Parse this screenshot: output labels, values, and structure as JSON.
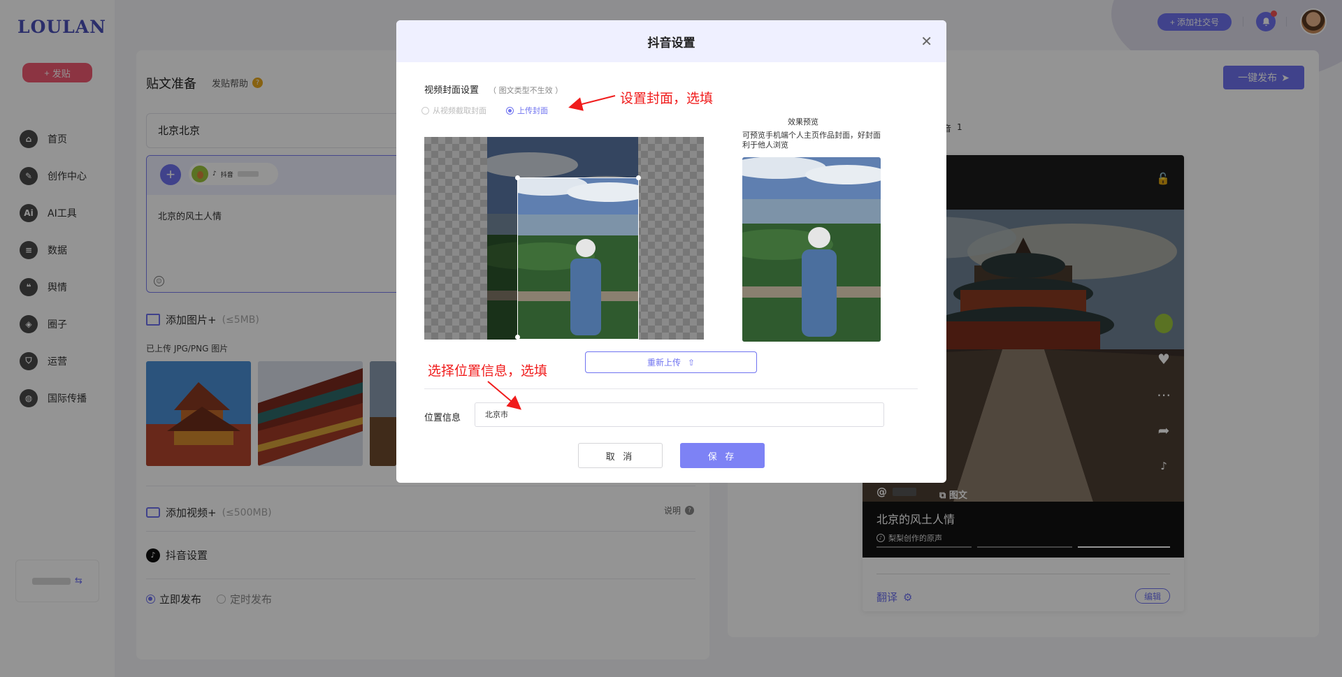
{
  "app": {
    "logo": "LOULAN",
    "post_button": "发贴"
  },
  "nav": {
    "items": [
      {
        "label": "首页",
        "icon": "home-icon",
        "glyph": "⌂"
      },
      {
        "label": "创作中心",
        "icon": "palette-icon",
        "glyph": "✎"
      },
      {
        "label": "AI工具",
        "icon": "ai-icon",
        "glyph": "Ai"
      },
      {
        "label": "数据",
        "icon": "database-icon",
        "glyph": "≡"
      },
      {
        "label": "舆情",
        "icon": "quote-icon",
        "glyph": "❝"
      },
      {
        "label": "圈子",
        "icon": "compass-icon",
        "glyph": "◈"
      },
      {
        "label": "运营",
        "icon": "shield-icon",
        "glyph": "⛉"
      },
      {
        "label": "国际传播",
        "icon": "globe-icon",
        "glyph": "◍"
      }
    ]
  },
  "header": {
    "add_account": "+ 添加社交号"
  },
  "editor": {
    "title": "贴文准备",
    "help": "发贴帮助",
    "post_title": "北京北京",
    "account_platform": "抖音",
    "content": "北京的风土人情",
    "images_label": "添加图片+",
    "images_limit": "(≤5MB)",
    "uploaded_hint": "已上传 JPG/PNG 图片",
    "video_label": "添加视频+",
    "video_limit": "(≤500MB)",
    "explain": "说明",
    "douyin_settings": "抖音设置",
    "publish_now": "立即发布",
    "publish_scheduled": "定时发布"
  },
  "preview": {
    "publish_button": "一键发布",
    "tab_fragment": "音",
    "tab_count": "1",
    "handle": "@",
    "type_tag": "图文",
    "title": "北京的风土人情",
    "music": "梨梨创作的原声",
    "translate": "翻译",
    "edit": "编辑"
  },
  "modal": {
    "title": "抖音设置",
    "cover_label": "视频封面设置",
    "cover_note": "（ 图文类型不生效 ）",
    "option_from_video": "从视频截取封面",
    "option_upload": "上传封面",
    "preview_title": "效果预览",
    "preview_desc": "可预览手机端个人主页作品封面，好封面利于他人浏览",
    "reupload": "重新上传",
    "location_label": "位置信息",
    "location_value": "北京市",
    "cancel": "取 消",
    "save": "保 存"
  },
  "annotations": {
    "cover": "设置封面，选填",
    "location": "选择位置信息，选填"
  },
  "colors": {
    "accent": "#6f73f0",
    "annotation": "#f01c1c",
    "post_button": "#f25a73"
  }
}
